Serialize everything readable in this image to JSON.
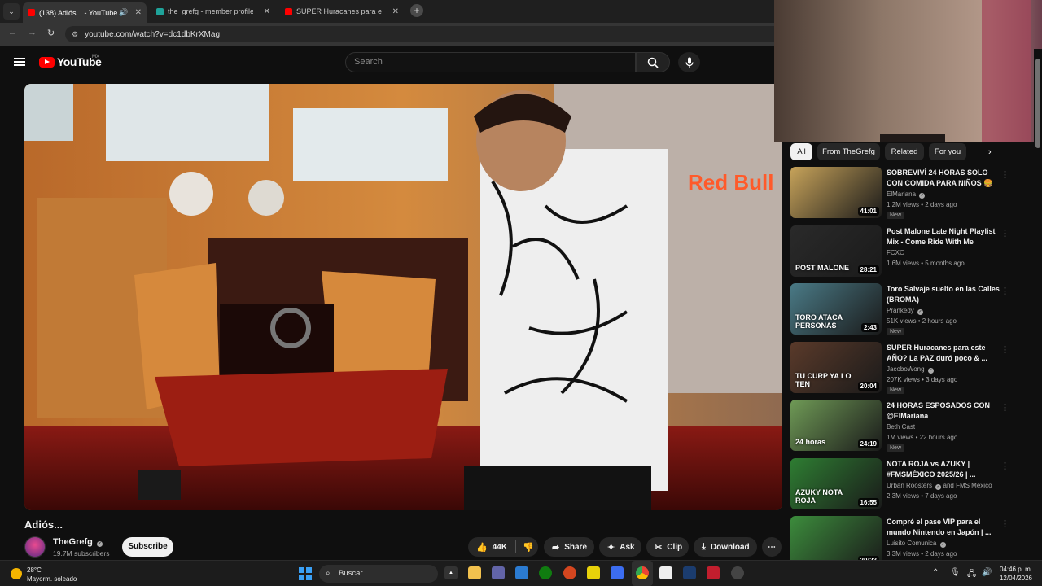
{
  "browser": {
    "tabs": [
      {
        "title": "(138) Adiós... - YouTube",
        "active": true
      },
      {
        "title": "the_grefg - member profile | Vu",
        "active": false
      },
      {
        "title": "SUPER Huracanes para este AÑO",
        "active": false
      }
    ],
    "url": "youtube.com/watch?v=dc1dbKrXMag"
  },
  "youtube": {
    "logo_text": "YouTube",
    "country_code": "MX",
    "search_placeholder": "Search"
  },
  "video": {
    "title": "Adiós...",
    "overlay_logo_text": "Red Bull",
    "channel_name": "TheGrefg",
    "subscribers": "19.7M subscribers",
    "subscribe_label": "Subscribe",
    "actions": {
      "likes": "44K",
      "share": "Share",
      "ask": "Ask",
      "clip": "Clip",
      "download": "Download"
    }
  },
  "chips": [
    "All",
    "From TheGrefg",
    "Related",
    "For you"
  ],
  "recommendations": [
    {
      "title": "SOBREVIVÍ 24 HORAS SOLO CON COMIDA PARA NIÑOS 🍔",
      "channel": "ElMariana",
      "verified": true,
      "views": "1.2M views",
      "age": "2 days ago",
      "badge": "New",
      "duration": "41:01",
      "thumb_color": "#c7a35a"
    },
    {
      "title": "Post Malone Late Night Playlist Mix - Come Ride With Me",
      "channel": "FCXO",
      "verified": false,
      "views": "1.6M views",
      "age": "5 months ago",
      "badge": "",
      "duration": "28:21",
      "thumb_color": "#2a2a2a",
      "thumb_text": "POST MALONE"
    },
    {
      "title": "Toro Salvaje suelto en las Calles (BROMA)",
      "channel": "Prankedy",
      "verified": true,
      "views": "51K views",
      "age": "2 hours ago",
      "badge": "New",
      "duration": "2:43",
      "thumb_color": "#4a7a86",
      "thumb_text": "TORO ATACA PERSONAS"
    },
    {
      "title": "SUPER Huracanes para este AÑO? La PAZ duró poco & ...",
      "channel": "JacoboWong",
      "verified": true,
      "views": "207K views",
      "age": "3 days ago",
      "badge": "New",
      "duration": "20:04",
      "thumb_color": "#5a3a2a",
      "thumb_text": "TU CURP YA LO TEN"
    },
    {
      "title": "24 HORAS ESPOSADOS CON @ElMariana",
      "channel": "Beth Cast",
      "verified": false,
      "views": "1M views",
      "age": "22 hours ago",
      "badge": "New",
      "duration": "24:19",
      "thumb_color": "#6f9a56",
      "thumb_text": "24 horas"
    },
    {
      "title": "NOTA ROJA vs AZUKY | #FMSMÉXICO 2025/26 | ...",
      "channel": "Urban Roosters",
      "verified": true,
      "channel_extra": "and FMS México",
      "views": "2.3M views",
      "age": "7 days ago",
      "badge": "",
      "duration": "16:55",
      "thumb_color": "#2e7d32",
      "thumb_text": "AZUKY NOTA ROJA"
    },
    {
      "title": "Compré el pase VIP para el mundo Nintendo en Japón | ...",
      "channel": "Luisito Comunica",
      "verified": true,
      "views": "3.3M views",
      "age": "2 days ago",
      "badge": "",
      "duration": "20:23",
      "thumb_color": "#3c8c3c"
    }
  ],
  "taskbar": {
    "weather_temp": "28°C",
    "weather_desc": "Mayorm. soleado",
    "search_label": "Buscar",
    "time": "04:46 p. m.",
    "date": "12/04/2026"
  },
  "colors": {
    "youtube_red": "#ff0000",
    "background": "#0f0f0f",
    "chip": "#272727"
  }
}
